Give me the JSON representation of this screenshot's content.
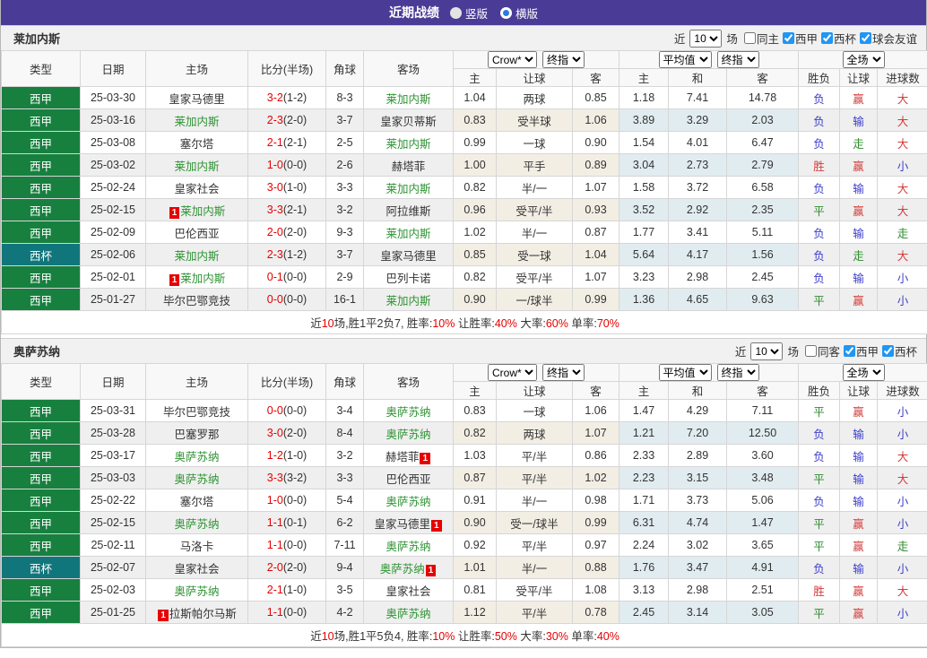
{
  "topbar": {
    "title": "近期战绩",
    "radios": [
      {
        "label": "竖版",
        "selected": false
      },
      {
        "label": "横版",
        "selected": true
      }
    ]
  },
  "colors": {
    "titlebar_purple": "#4A3C96",
    "liga_green": "#17803F",
    "cup_teal": "#11767B",
    "self_team_green": "#2E9333",
    "score_red": "#E60000",
    "win_red": "#D43B3B",
    "lose_blue": "#3C3CCC",
    "draw_green": "#2E8B2E"
  },
  "columns": [
    "类型",
    "日期",
    "主场",
    "比分(半场)",
    "角球",
    "客场",
    "主",
    "让球",
    "客",
    "主",
    "和",
    "客",
    "胜负",
    "让球",
    "进球数"
  ],
  "sections": [
    {
      "team": "莱加内斯",
      "filter": {
        "near_label": "近",
        "count": "10",
        "games_label": "场",
        "checkboxes": [
          {
            "label": "同主",
            "checked": false
          },
          {
            "label": "西甲",
            "checked": true
          },
          {
            "label": "西杯",
            "checked": true
          },
          {
            "label": "球会友谊",
            "checked": true
          }
        ]
      },
      "selects": {
        "crow": "Crow*",
        "final1": "终指",
        "avg": "平均值",
        "final2": "终指",
        "full": "全场"
      },
      "rows": [
        {
          "type": "西甲",
          "date": "25-03-30",
          "home": {
            "n": "皇家马德里"
          },
          "score": "3-2",
          "half": "(1-2)",
          "corner": "8-3",
          "away": {
            "n": "莱加内斯",
            "self": true
          },
          "crow": [
            "1.04",
            "两球",
            "0.85"
          ],
          "avg": [
            "1.18",
            "7.41",
            "14.78"
          ],
          "result": [
            "负",
            "赢",
            "大"
          ]
        },
        {
          "type": "西甲",
          "date": "25-03-16",
          "home": {
            "n": "莱加内斯",
            "self": true
          },
          "score": "2-3",
          "half": "(2-0)",
          "corner": "3-7",
          "away": {
            "n": "皇家贝蒂斯"
          },
          "crow": [
            "0.83",
            "受半球",
            "1.06"
          ],
          "avg": [
            "3.89",
            "3.29",
            "2.03"
          ],
          "result": [
            "负",
            "输",
            "大"
          ]
        },
        {
          "type": "西甲",
          "date": "25-03-08",
          "home": {
            "n": "塞尔塔"
          },
          "score": "2-1",
          "half": "(2-1)",
          "corner": "2-5",
          "away": {
            "n": "莱加内斯",
            "self": true
          },
          "crow": [
            "0.99",
            "一球",
            "0.90"
          ],
          "avg": [
            "1.54",
            "4.01",
            "6.47"
          ],
          "result": [
            "负",
            "走",
            "大"
          ]
        },
        {
          "type": "西甲",
          "date": "25-03-02",
          "home": {
            "n": "莱加内斯",
            "self": true
          },
          "score": "1-0",
          "half": "(0-0)",
          "corner": "2-6",
          "away": {
            "n": "赫塔菲"
          },
          "crow": [
            "1.00",
            "平手",
            "0.89"
          ],
          "avg": [
            "3.04",
            "2.73",
            "2.79"
          ],
          "result": [
            "胜",
            "赢",
            "小"
          ]
        },
        {
          "type": "西甲",
          "date": "25-02-24",
          "home": {
            "n": "皇家社会"
          },
          "score": "3-0",
          "half": "(1-0)",
          "corner": "3-3",
          "away": {
            "n": "莱加内斯",
            "self": true
          },
          "crow": [
            "0.82",
            "半/一",
            "1.07"
          ],
          "avg": [
            "1.58",
            "3.72",
            "6.58"
          ],
          "result": [
            "负",
            "输",
            "大"
          ]
        },
        {
          "type": "西甲",
          "date": "25-02-15",
          "home": {
            "n": "莱加内斯",
            "self": true,
            "card": "before"
          },
          "score": "3-3",
          "half": "(2-1)",
          "corner": "3-2",
          "away": {
            "n": "阿拉维斯"
          },
          "crow": [
            "0.96",
            "受平/半",
            "0.93"
          ],
          "avg": [
            "3.52",
            "2.92",
            "2.35"
          ],
          "result": [
            "平",
            "赢",
            "大"
          ]
        },
        {
          "type": "西甲",
          "date": "25-02-09",
          "home": {
            "n": "巴伦西亚"
          },
          "score": "2-0",
          "half": "(2-0)",
          "corner": "9-3",
          "away": {
            "n": "莱加内斯",
            "self": true
          },
          "crow": [
            "1.02",
            "半/一",
            "0.87"
          ],
          "avg": [
            "1.77",
            "3.41",
            "5.11"
          ],
          "result": [
            "负",
            "输",
            "走"
          ]
        },
        {
          "type": "西杯",
          "date": "25-02-06",
          "home": {
            "n": "莱加内斯",
            "self": true
          },
          "score": "2-3",
          "half": "(1-2)",
          "corner": "3-7",
          "away": {
            "n": "皇家马德里"
          },
          "crow": [
            "0.85",
            "受一球",
            "1.04"
          ],
          "avg": [
            "5.64",
            "4.17",
            "1.56"
          ],
          "result": [
            "负",
            "走",
            "大"
          ]
        },
        {
          "type": "西甲",
          "date": "25-02-01",
          "home": {
            "n": "莱加内斯",
            "self": true,
            "card": "before"
          },
          "score": "0-1",
          "half": "(0-0)",
          "corner": "2-9",
          "away": {
            "n": "巴列卡诺"
          },
          "crow": [
            "0.82",
            "受平/半",
            "1.07"
          ],
          "avg": [
            "3.23",
            "2.98",
            "2.45"
          ],
          "result": [
            "负",
            "输",
            "小"
          ]
        },
        {
          "type": "西甲",
          "date": "25-01-27",
          "home": {
            "n": "毕尔巴鄂竞技"
          },
          "score": "0-0",
          "half": "(0-0)",
          "corner": "16-1",
          "away": {
            "n": "莱加内斯",
            "self": true
          },
          "crow": [
            "0.90",
            "一/球半",
            "0.99"
          ],
          "avg": [
            "1.36",
            "4.65",
            "9.63"
          ],
          "result": [
            "平",
            "赢",
            "小"
          ]
        }
      ],
      "summary": [
        {
          "t": "近",
          "r": false
        },
        {
          "t": "10",
          "r": true
        },
        {
          "t": "场,胜1平2负7, 胜率:",
          "r": false
        },
        {
          "t": "10%",
          "r": true
        },
        {
          "t": " 让胜率:",
          "r": false
        },
        {
          "t": "40%",
          "r": true
        },
        {
          "t": " 大率:",
          "r": false
        },
        {
          "t": "60%",
          "r": true
        },
        {
          "t": " 单率:",
          "r": false
        },
        {
          "t": "70%",
          "r": true
        }
      ]
    },
    {
      "team": "奥萨苏纳",
      "filter": {
        "near_label": "近",
        "count": "10",
        "games_label": "场",
        "checkboxes": [
          {
            "label": "同客",
            "checked": false
          },
          {
            "label": "西甲",
            "checked": true
          },
          {
            "label": "西杯",
            "checked": true
          }
        ]
      },
      "selects": {
        "crow": "Crow*",
        "final1": "终指",
        "avg": "平均值",
        "final2": "终指",
        "full": "全场"
      },
      "rows": [
        {
          "type": "西甲",
          "date": "25-03-31",
          "home": {
            "n": "毕尔巴鄂竞技"
          },
          "score": "0-0",
          "half": "(0-0)",
          "corner": "3-4",
          "away": {
            "n": "奥萨苏纳",
            "self": true
          },
          "crow": [
            "0.83",
            "一球",
            "1.06"
          ],
          "avg": [
            "1.47",
            "4.29",
            "7.11"
          ],
          "result": [
            "平",
            "赢",
            "小"
          ]
        },
        {
          "type": "西甲",
          "date": "25-03-28",
          "home": {
            "n": "巴塞罗那"
          },
          "score": "3-0",
          "half": "(2-0)",
          "corner": "8-4",
          "away": {
            "n": "奥萨苏纳",
            "self": true
          },
          "crow": [
            "0.82",
            "两球",
            "1.07"
          ],
          "avg": [
            "1.21",
            "7.20",
            "12.50"
          ],
          "result": [
            "负",
            "输",
            "小"
          ]
        },
        {
          "type": "西甲",
          "date": "25-03-17",
          "home": {
            "n": "奥萨苏纳",
            "self": true
          },
          "score": "1-2",
          "half": "(1-0)",
          "corner": "3-2",
          "away": {
            "n": "赫塔菲",
            "card": "after"
          },
          "crow": [
            "1.03",
            "平/半",
            "0.86"
          ],
          "avg": [
            "2.33",
            "2.89",
            "3.60"
          ],
          "result": [
            "负",
            "输",
            "大"
          ]
        },
        {
          "type": "西甲",
          "date": "25-03-03",
          "home": {
            "n": "奥萨苏纳",
            "self": true
          },
          "score": "3-3",
          "half": "(3-2)",
          "corner": "3-3",
          "away": {
            "n": "巴伦西亚"
          },
          "crow": [
            "0.87",
            "平/半",
            "1.02"
          ],
          "avg": [
            "2.23",
            "3.15",
            "3.48"
          ],
          "result": [
            "平",
            "输",
            "大"
          ]
        },
        {
          "type": "西甲",
          "date": "25-02-22",
          "home": {
            "n": "塞尔塔"
          },
          "score": "1-0",
          "half": "(0-0)",
          "corner": "5-4",
          "away": {
            "n": "奥萨苏纳",
            "self": true
          },
          "crow": [
            "0.91",
            "半/一",
            "0.98"
          ],
          "avg": [
            "1.71",
            "3.73",
            "5.06"
          ],
          "result": [
            "负",
            "输",
            "小"
          ]
        },
        {
          "type": "西甲",
          "date": "25-02-15",
          "home": {
            "n": "奥萨苏纳",
            "self": true
          },
          "score": "1-1",
          "half": "(0-1)",
          "corner": "6-2",
          "away": {
            "n": "皇家马德里",
            "card": "after"
          },
          "crow": [
            "0.90",
            "受一/球半",
            "0.99"
          ],
          "avg": [
            "6.31",
            "4.74",
            "1.47"
          ],
          "result": [
            "平",
            "赢",
            "小"
          ]
        },
        {
          "type": "西甲",
          "date": "25-02-11",
          "home": {
            "n": "马洛卡"
          },
          "score": "1-1",
          "half": "(0-0)",
          "corner": "7-11",
          "away": {
            "n": "奥萨苏纳",
            "self": true
          },
          "crow": [
            "0.92",
            "平/半",
            "0.97"
          ],
          "avg": [
            "2.24",
            "3.02",
            "3.65"
          ],
          "result": [
            "平",
            "赢",
            "走"
          ]
        },
        {
          "type": "西杯",
          "date": "25-02-07",
          "home": {
            "n": "皇家社会"
          },
          "score": "2-0",
          "half": "(2-0)",
          "corner": "9-4",
          "away": {
            "n": "奥萨苏纳",
            "self": true,
            "card": "after"
          },
          "crow": [
            "1.01",
            "半/一",
            "0.88"
          ],
          "avg": [
            "1.76",
            "3.47",
            "4.91"
          ],
          "result": [
            "负",
            "输",
            "小"
          ]
        },
        {
          "type": "西甲",
          "date": "25-02-03",
          "home": {
            "n": "奥萨苏纳",
            "self": true
          },
          "score": "2-1",
          "half": "(1-0)",
          "corner": "3-5",
          "away": {
            "n": "皇家社会"
          },
          "crow": [
            "0.81",
            "受平/半",
            "1.08"
          ],
          "avg": [
            "3.13",
            "2.98",
            "2.51"
          ],
          "result": [
            "胜",
            "赢",
            "大"
          ]
        },
        {
          "type": "西甲",
          "date": "25-01-25",
          "home": {
            "n": "拉斯帕尔马斯",
            "card": "before"
          },
          "score": "1-1",
          "half": "(0-0)",
          "corner": "4-2",
          "away": {
            "n": "奥萨苏纳",
            "self": true
          },
          "crow": [
            "1.12",
            "平/半",
            "0.78"
          ],
          "avg": [
            "2.45",
            "3.14",
            "3.05"
          ],
          "result": [
            "平",
            "赢",
            "小"
          ]
        }
      ],
      "summary": [
        {
          "t": "近",
          "r": false
        },
        {
          "t": "10",
          "r": true
        },
        {
          "t": "场,胜1平5负4, 胜率:",
          "r": false
        },
        {
          "t": "10%",
          "r": true
        },
        {
          "t": " 让胜率:",
          "r": false
        },
        {
          "t": "50%",
          "r": true
        },
        {
          "t": " 大率:",
          "r": false
        },
        {
          "t": "30%",
          "r": true
        },
        {
          "t": " 单率:",
          "r": false
        },
        {
          "t": "40%",
          "r": true
        }
      ]
    }
  ]
}
